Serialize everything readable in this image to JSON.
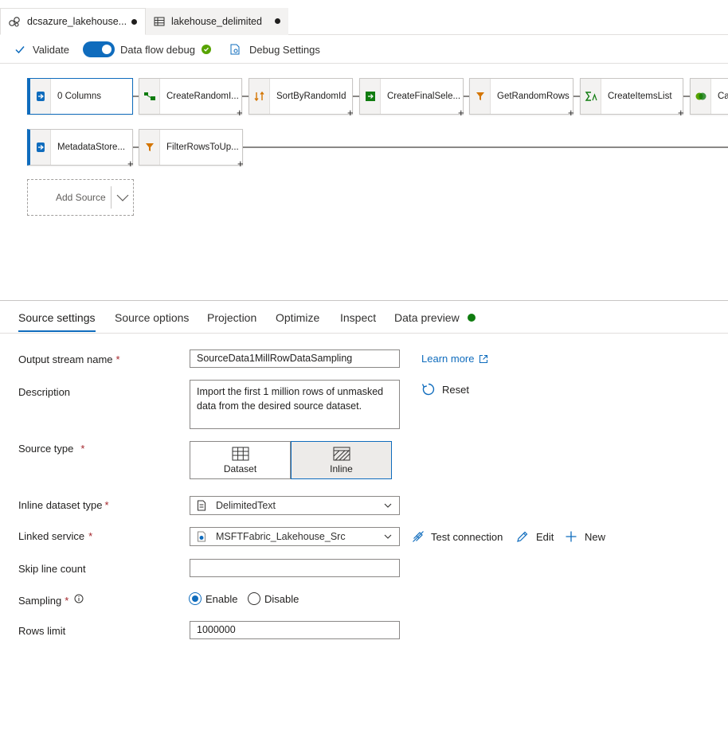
{
  "tabs": [
    {
      "label": "dcsazure_lakehouse..."
    },
    {
      "label": "lakehouse_delimited"
    }
  ],
  "toolbar": {
    "validate": "Validate",
    "debug": "Data flow debug",
    "debug_settings": "Debug Settings"
  },
  "flow": {
    "row1": [
      "0 Columns",
      "CreateRandomI...",
      "SortByRandomId",
      "CreateFinalSele...",
      "GetRandomRows",
      "CreateItemsList",
      "Ca"
    ],
    "row2": [
      "MetadataStore...",
      "FilterRowsToUp..."
    ],
    "add_source": "Add Source",
    "plus": "+"
  },
  "settings_tabs": [
    "Source settings",
    "Source options",
    "Projection",
    "Optimize",
    "Inspect",
    "Data preview"
  ],
  "form": {
    "output_stream_label": "Output stream name",
    "output_stream_value": "SourceData1MillRowDataSampling",
    "learn_more": "Learn more",
    "description_label": "Description",
    "description_value": "Import the first 1 million rows of unmasked data from the desired source dataset.",
    "reset": "Reset",
    "source_type_label": "Source type",
    "source_type_dataset": "Dataset",
    "source_type_inline": "Inline",
    "inline_type_label": "Inline dataset type",
    "inline_type_value": "DelimitedText",
    "linked_service_label": "Linked service",
    "linked_service_value": "MSFTFabric_Lakehouse_Src",
    "test_connection": "Test connection",
    "edit": "Edit",
    "new": "New",
    "skip_line_label": "Skip line count",
    "skip_line_value": "",
    "sampling_label": "Sampling",
    "sampling_enable": "Enable",
    "sampling_disable": "Disable",
    "rows_limit_label": "Rows limit",
    "rows_limit_value": "1000000",
    "required_mark": "*"
  },
  "colors": {
    "accent": "#0f6cbd",
    "success": "#107c10",
    "required": "#a4262c"
  }
}
